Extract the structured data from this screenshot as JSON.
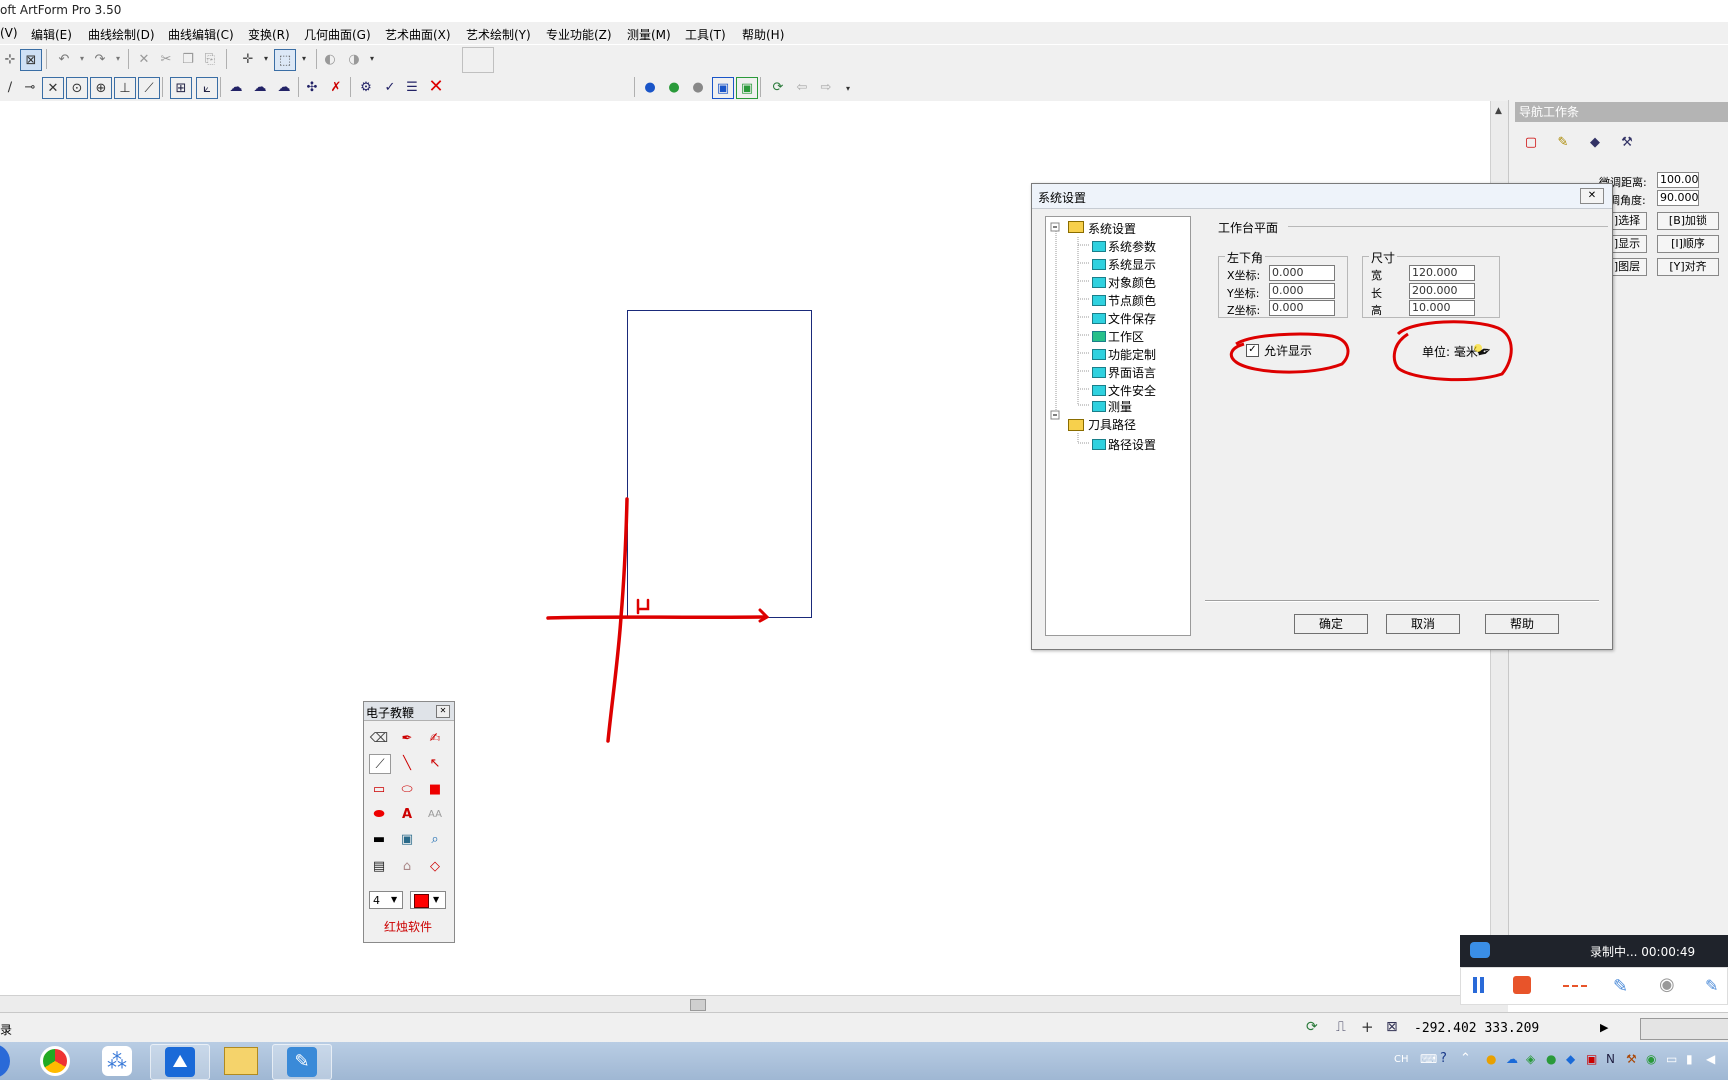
{
  "window": {
    "title": "oft ArtForm Pro 3.50"
  },
  "menu": [
    {
      "label": "(V)"
    },
    {
      "label": "编辑(E)"
    },
    {
      "label": "曲线绘制(D)"
    },
    {
      "label": "曲线编辑(C)"
    },
    {
      "label": "变换(R)"
    },
    {
      "label": "几何曲面(G)"
    },
    {
      "label": "艺术曲面(X)"
    },
    {
      "label": "艺术绘制(Y)"
    },
    {
      "label": "专业功能(Z)"
    },
    {
      "label": "测量(M)"
    },
    {
      "label": "工具(T)"
    },
    {
      "label": "帮助(H)"
    }
  ],
  "nav_panel": {
    "title": "导航工作条",
    "fine_distance_label": "微调距离:",
    "fine_distance_value": "100.00",
    "fine_angle_label": "调角度:",
    "fine_angle_value": "90.000",
    "buttons": [
      "]选择",
      "[B]加锁",
      "]显示",
      "[I]顺序",
      "]图层",
      "[Y]对齐"
    ]
  },
  "dialog": {
    "title": "系统设置",
    "tree": {
      "root1": "系统设置",
      "children1": [
        "系统参数",
        "系统显示",
        "对象颜色",
        "节点颜色",
        "文件保存",
        "工作区",
        "功能定制",
        "界面语言",
        "文件安全",
        "测量"
      ],
      "root2": "刀具路径",
      "children2": [
        "路径设置"
      ]
    },
    "section_title": "工作台平面",
    "corner_group": {
      "label": "左下角",
      "x_label": "X坐标:",
      "x_value": "0.000",
      "y_label": "Y坐标:",
      "y_value": "0.000",
      "z_label": "Z坐标:",
      "z_value": "0.000"
    },
    "size_group": {
      "label": "尺寸",
      "w_label": "宽",
      "w_value": "120.000",
      "l_label": "长",
      "l_value": "200.000",
      "h_label": "高",
      "h_value": "10.000"
    },
    "allow_display_label": "允许显示",
    "allow_display_checked": true,
    "unit_label": "单位: 毫米",
    "ok_label": "确定",
    "cancel_label": "取消",
    "help_label": "帮助"
  },
  "eboard": {
    "title": "电子教鞭",
    "width_value": "4",
    "color": "#ff0000",
    "brand": "红烛软件"
  },
  "recorder": {
    "status": "录制中... 00:00:49"
  },
  "statusbar": {
    "left_text": "录",
    "coords": "-292.402  333.209",
    "mode": "U"
  },
  "tray": {
    "lang": "CH"
  },
  "colors": {
    "annotation": "#dd0000",
    "workspace_rect": "#1a2a7a",
    "dialog_title_bg": "#eef3fa"
  }
}
